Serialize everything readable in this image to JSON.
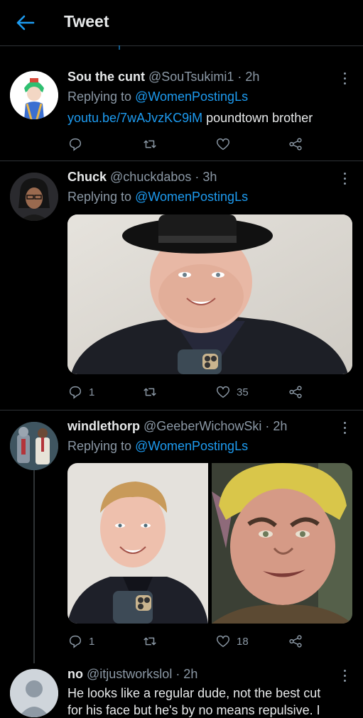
{
  "header": {
    "title": "Tweet",
    "back_icon": "back-arrow-icon",
    "accent": "#1d9bf0"
  },
  "tweets": [
    {
      "name": "Sou the cunt",
      "handle": "@SouTsukimi1 · 2h",
      "replying_prefix": "Replying to ",
      "replying_to": "@WomenPostingLs",
      "link": "youtu.be/7wAJvzKC9iM",
      "text": " poundtown brother",
      "actions": {
        "reply": "",
        "retweet": "",
        "like": ""
      }
    },
    {
      "name": "Chuck",
      "handle": "@chuckdabos · 3h",
      "replying_prefix": "Replying to ",
      "replying_to": "@WomenPostingLs",
      "actions": {
        "reply": "1",
        "retweet": "",
        "like": "35"
      }
    },
    {
      "name": "windlethorp",
      "handle": "@GeeberWichowSki · 2h",
      "replying_prefix": "Replying to ",
      "replying_to": "@WomenPostingLs",
      "actions": {
        "reply": "1",
        "retweet": "",
        "like": "18"
      }
    },
    {
      "name": "no",
      "handle": "@itjustworkslol · 2h",
      "text": "He looks like a regular dude, not the best cut",
      "text2": "for his face but he's by no means repulsive. I"
    }
  ]
}
